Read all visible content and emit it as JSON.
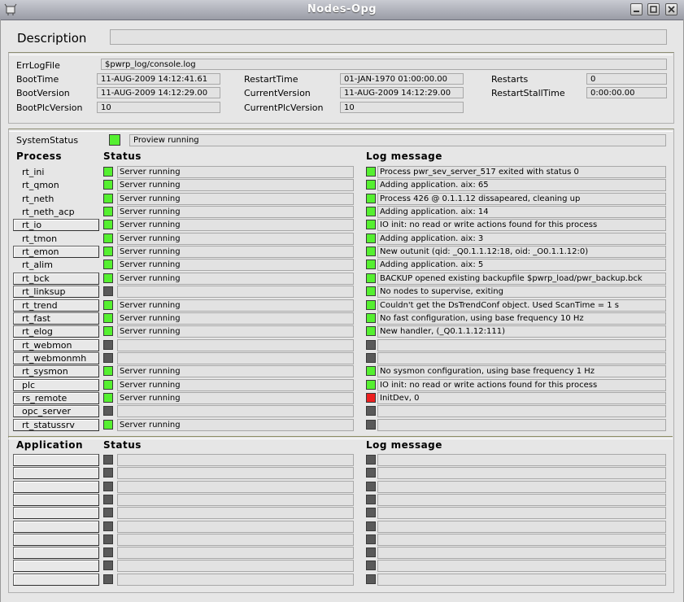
{
  "window": {
    "title": "Nodes-Opg"
  },
  "colors": {
    "green": "#55f030",
    "gray": "#5a5a5a",
    "red": "#ec1f1f"
  },
  "description": {
    "label": "Description",
    "value": ""
  },
  "info": {
    "errlog_label": "ErrLogFile",
    "errlog_value": "$pwrp_log/console.log",
    "boottime_label": "BootTime",
    "boottime_value": "11-AUG-2009 14:12:41.61",
    "bootversion_label": "BootVersion",
    "bootversion_value": "11-AUG-2009 14:12:29.00",
    "bootplcversion_label": "BootPlcVersion",
    "bootplcversion_value": "10",
    "restarttime_label": "RestartTime",
    "restarttime_value": "01-JAN-1970 01:00:00.00",
    "currentversion_label": "CurrentVersion",
    "currentversion_value": "11-AUG-2009 14:12:29.00",
    "currentplcversion_label": "CurrentPlcVersion",
    "currentplcversion_value": "10",
    "restarts_label": "Restarts",
    "restarts_value": "0",
    "restartstall_label": "RestartStallTime",
    "restartstall_value": "0:00:00.00"
  },
  "system": {
    "label": "SystemStatus",
    "value": "Proview running",
    "color": "green"
  },
  "process_headers": {
    "process": "Process",
    "status": "Status",
    "log": "Log message"
  },
  "processes": [
    {
      "name": "rt_ini",
      "button": false,
      "s": "green",
      "status": "Server running",
      "l": "green",
      "log": "Process pwr_sev_server_517 exited with status 0"
    },
    {
      "name": "rt_qmon",
      "button": false,
      "s": "green",
      "status": "Server running",
      "l": "green",
      "log": "Adding application. aix: 65"
    },
    {
      "name": "rt_neth",
      "button": false,
      "s": "green",
      "status": "Server running",
      "l": "green",
      "log": "Process 426 @ 0.1.1.12 dissapeared, cleaning up"
    },
    {
      "name": "rt_neth_acp",
      "button": false,
      "s": "green",
      "status": "Server running",
      "l": "green",
      "log": "Adding application. aix: 14"
    },
    {
      "name": "rt_io",
      "button": true,
      "s": "green",
      "status": "Server running",
      "l": "green",
      "log": "IO init: no read or write actions found for this process"
    },
    {
      "name": "rt_tmon",
      "button": false,
      "s": "green",
      "status": "Server running",
      "l": "green",
      "log": "Adding application. aix: 3"
    },
    {
      "name": "rt_emon",
      "button": true,
      "s": "green",
      "status": "Server running",
      "l": "green",
      "log": "New outunit (qid: _Q0.1.1.12:18, oid: _O0.1.1.12:0)"
    },
    {
      "name": "rt_alim",
      "button": false,
      "s": "green",
      "status": "Server running",
      "l": "green",
      "log": "Adding application. aix: 5"
    },
    {
      "name": "rt_bck",
      "button": true,
      "s": "green",
      "status": "Server running",
      "l": "green",
      "log": "BACKUP opened existing backupfile $pwrp_load/pwr_backup.bck"
    },
    {
      "name": "rt_linksup",
      "button": true,
      "s": "gray",
      "status": "",
      "l": "green",
      "log": "No nodes to supervise, exiting"
    },
    {
      "name": "rt_trend",
      "button": true,
      "s": "green",
      "status": "Server running",
      "l": "green",
      "log": "Couldn't get the DsTrendConf object. Used ScanTime = 1 s"
    },
    {
      "name": "rt_fast",
      "button": true,
      "s": "green",
      "status": "Server running",
      "l": "green",
      "log": "No fast configuration, using base frequency 10 Hz"
    },
    {
      "name": "rt_elog",
      "button": true,
      "s": "green",
      "status": "Server running",
      "l": "green",
      "log": "New handler, (_Q0.1.1.12:111)"
    },
    {
      "name": "rt_webmon",
      "button": true,
      "s": "gray",
      "status": "",
      "l": "gray",
      "log": ""
    },
    {
      "name": "rt_webmonmh",
      "button": true,
      "s": "gray",
      "status": "",
      "l": "gray",
      "log": ""
    },
    {
      "name": "rt_sysmon",
      "button": true,
      "s": "green",
      "status": "Server running",
      "l": "green",
      "log": "No sysmon configuration, using base frequency 1 Hz"
    },
    {
      "name": "plc",
      "button": true,
      "s": "green",
      "status": "Server running",
      "l": "green",
      "log": "IO init: no read or write actions found for this process"
    },
    {
      "name": "rs_remote",
      "button": true,
      "s": "green",
      "status": "Server running",
      "l": "red",
      "log": "InitDev, 0"
    },
    {
      "name": "opc_server",
      "button": true,
      "s": "gray",
      "status": "",
      "l": "gray",
      "log": ""
    },
    {
      "name": "rt_statussrv",
      "button": true,
      "s": "green",
      "status": "Server running",
      "l": "gray",
      "log": ""
    }
  ],
  "app_headers": {
    "application": "Application",
    "status": "Status",
    "log": "Log message"
  },
  "applications": [
    {
      "name": "",
      "s": "gray",
      "status": "",
      "l": "gray",
      "log": ""
    },
    {
      "name": "",
      "s": "gray",
      "status": "",
      "l": "gray",
      "log": ""
    },
    {
      "name": "",
      "s": "gray",
      "status": "",
      "l": "gray",
      "log": ""
    },
    {
      "name": "",
      "s": "gray",
      "status": "",
      "l": "gray",
      "log": ""
    },
    {
      "name": "",
      "s": "gray",
      "status": "",
      "l": "gray",
      "log": ""
    },
    {
      "name": "",
      "s": "gray",
      "status": "",
      "l": "gray",
      "log": ""
    },
    {
      "name": "",
      "s": "gray",
      "status": "",
      "l": "gray",
      "log": ""
    },
    {
      "name": "",
      "s": "gray",
      "status": "",
      "l": "gray",
      "log": ""
    },
    {
      "name": "",
      "s": "gray",
      "status": "",
      "l": "gray",
      "log": ""
    },
    {
      "name": "",
      "s": "gray",
      "status": "",
      "l": "gray",
      "log": ""
    }
  ]
}
